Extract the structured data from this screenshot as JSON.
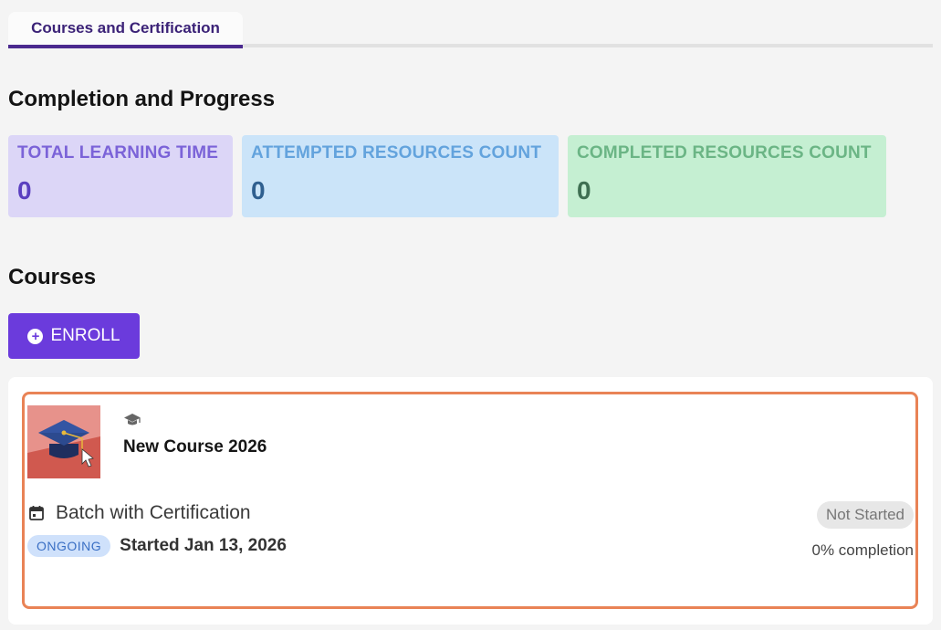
{
  "tabs": [
    {
      "label": "Courses and Certification",
      "active": true
    }
  ],
  "progress_section": {
    "title": "Completion and Progress"
  },
  "stats": {
    "total_learning_time": {
      "label": "TOTAL LEARNING TIME",
      "value": "0"
    },
    "attempted_resources": {
      "label": "ATTEMPTED RESOURCES COUNT",
      "value": "0"
    },
    "completed_resources": {
      "label": "COMPLETED RESOURCES COUNT",
      "value": "0"
    }
  },
  "courses_section": {
    "title": "Courses",
    "enroll_label": "ENROLL"
  },
  "course": {
    "title": "New Course 2026",
    "type_icon": "graduation-cap-icon",
    "thumbnail_icon": "graduation-cap-cursor-icon",
    "batch_name": "Batch with Certification",
    "batch_state": "ONGOING",
    "start_text": "Started Jan 13, 2026",
    "status": "Not Started",
    "completion_text": "0% completion",
    "completion_percent": 0
  },
  "colors": {
    "accent": "#6b3bdc",
    "tab_text": "#3b2277",
    "card_border": "#e98356"
  }
}
